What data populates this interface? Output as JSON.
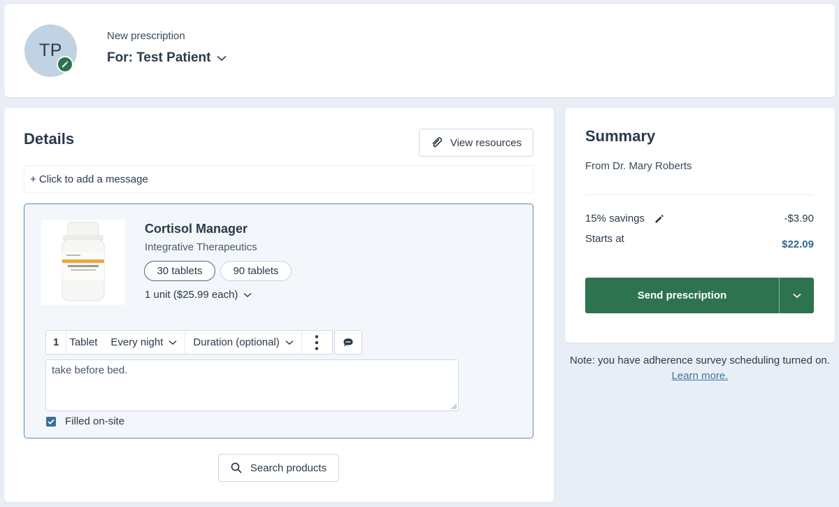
{
  "header": {
    "avatar_initials": "TP",
    "subtitle": "New prescription",
    "patient_label": "For: Test Patient"
  },
  "details": {
    "title": "Details",
    "view_resources_label": "View resources",
    "add_message_label": "+ Click to add a message",
    "product": {
      "name": "Cortisol Manager",
      "brand": "Integrative Therapeutics",
      "options": [
        {
          "label": "30 tablets",
          "selected": true
        },
        {
          "label": "90 tablets",
          "selected": false
        }
      ],
      "unit_label": "1 unit ($25.99 each)",
      "dosage": {
        "quantity": "1",
        "unit": "Tablet",
        "frequency": "Every night",
        "duration_placeholder": "Duration (optional)"
      },
      "instructions": "take before bed.",
      "filled_on_site_label": "Filled on-site",
      "filled_on_site": true
    },
    "search_products_label": "Search products"
  },
  "summary": {
    "title": "Summary",
    "from": "From Dr. Mary Roberts",
    "savings_label": "15% savings",
    "savings_value": "-$3.90",
    "starts_label": "Starts at",
    "starts_value": "$22.09",
    "send_label": "Send prescription"
  },
  "note": {
    "text": "Note: you have adherence survey scheduling turned on.",
    "link_label": "Learn more."
  },
  "colors": {
    "primary_green": "#2d7350",
    "accent_blue": "#2f6690",
    "background": "#e9eef6"
  }
}
